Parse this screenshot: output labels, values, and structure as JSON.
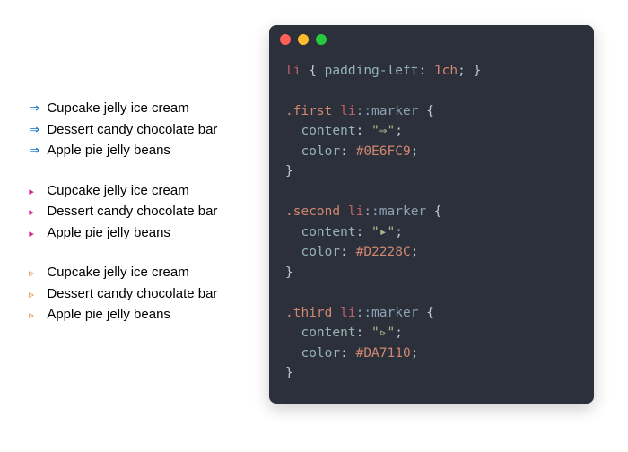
{
  "lists": {
    "items": [
      "Cupcake jelly ice cream",
      "Dessert candy chocolate bar",
      "Apple pie jelly beans"
    ],
    "first": {
      "marker": "⇒",
      "color": "#0E6FC9"
    },
    "second": {
      "marker": "▸",
      "color": "#D2228C"
    },
    "third": {
      "marker": "▹",
      "color": "#DA7110"
    }
  },
  "code": {
    "line1": {
      "tag": "li",
      "brace_open": "{",
      "prop": "padding-left",
      "colon": ":",
      "val": "1ch",
      "semi": ";",
      "brace_close": "}"
    },
    "rules": [
      {
        "sel": ".first",
        "tag": "li",
        "pseudo": "::marker",
        "content_prop": "content",
        "content_val": "\"⇒\"",
        "color_prop": "color",
        "color_val": "#0E6FC9"
      },
      {
        "sel": ".second",
        "tag": "li",
        "pseudo": "::marker",
        "content_prop": "content",
        "content_val": "\"▸\"",
        "color_prop": "color",
        "color_val": "#D2228C"
      },
      {
        "sel": ".third",
        "tag": "li",
        "pseudo": "::marker",
        "content_prop": "content",
        "content_val": "\"▹\"",
        "color_prop": "color",
        "color_val": "#DA7110"
      }
    ],
    "brace_open": "{",
    "brace_close": "}",
    "semi": ";",
    "colon": ":"
  }
}
